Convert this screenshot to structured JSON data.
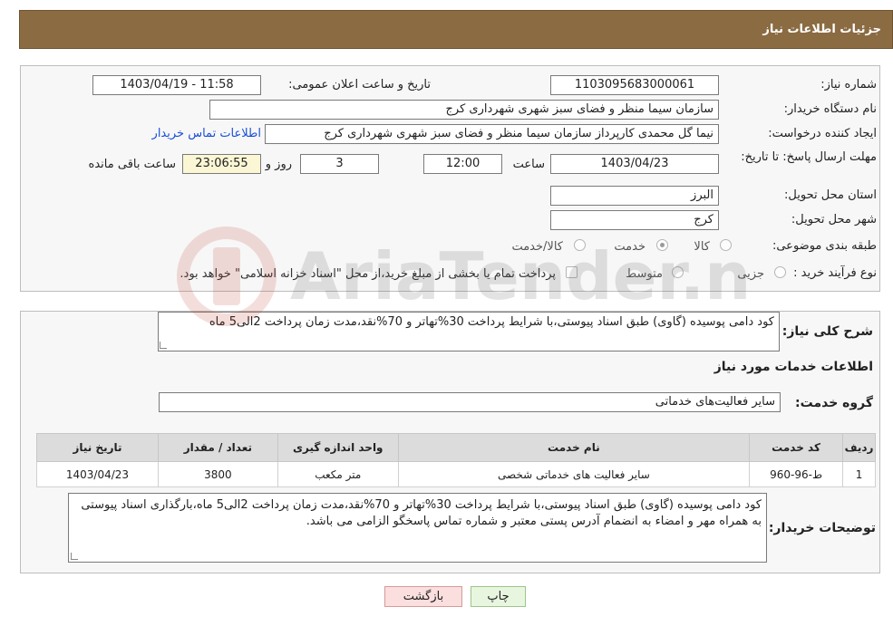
{
  "header": {
    "title": "جزئیات اطلاعات نیاز"
  },
  "labels": {
    "need_number": "شماره نیاز:",
    "announce_datetime": "تاریخ و ساعت اعلان عمومی:",
    "buyer_org": "نام دستگاه خریدار:",
    "request_creator": "ایجاد کننده درخواست:",
    "deadline": "مهلت ارسال پاسخ: تا تاریخ:",
    "time": "ساعت",
    "days_and": "روز و",
    "remaining": "ساعت باقی مانده",
    "province": "استان محل تحویل:",
    "city": "شهر محل تحویل:",
    "category": "طبقه بندی موضوعی:",
    "purchase_type": "نوع فرآیند خرید :",
    "general_description": "شرح کلی نیاز:",
    "services_info": "اطلاعات خدمات مورد نیاز",
    "service_group": "گروه خدمت:",
    "buyer_notes": "توضیحات خریدار:"
  },
  "values": {
    "need_number": "1103095683000061",
    "announce_datetime": "1403/04/19 - 11:58",
    "buyer_org": "سازمان سیما منظر و فضای سبز شهری شهرداری کرج",
    "request_creator": "نیما گل محمدی کارپرداز سازمان سیما منظر و فضای سبز شهری شهرداری کرج",
    "deadline_date": "1403/04/23",
    "deadline_time": "12:00",
    "days": "3",
    "remaining_time": "23:06:55",
    "province": "البرز",
    "city": "کرج",
    "general_description": "کود دامی پوسیده (گاوی) طبق اسناد پیوستی،با شرایط پرداخت 30%تهاتر و 70%نقد،مدت زمان پرداخت 2الی5 ماه",
    "service_group": "سایر فعالیت‌های خدماتی",
    "buyer_notes": "کود دامی پوسیده (گاوی) طبق اسناد پیوستی،با شرایط پرداخت 30%تهاتر و 70%نقد،مدت زمان پرداخت 2الی5 ماه،بارگذاری اسناد پیوستی به همراه مهر و امضاء به انضمام آدرس پستی معتبر و شماره تماس پاسخگو الزامی می باشد."
  },
  "links": {
    "buyer_contact": "اطلاعات تماس خریدار"
  },
  "category_options": [
    "کالا",
    "خدمت",
    "کالا/خدمت"
  ],
  "category_selected": "خدمت",
  "purchase_options": [
    "جزیی",
    "متوسط"
  ],
  "treasury_note": "پرداخت تمام یا بخشی از مبلغ خرید،از محل \"اسناد خزانه اسلامی\" خواهد بود.",
  "table": {
    "headers": [
      "ردیف",
      "کد خدمت",
      "نام خدمت",
      "واحد اندازه گیری",
      "تعداد / مقدار",
      "تاریخ نیاز"
    ],
    "rows": [
      [
        "1",
        "ط-96-960",
        "سایر فعالیت های خدماتی شخصی",
        "متر مکعب",
        "3800",
        "1403/04/23"
      ]
    ]
  },
  "buttons": {
    "print": "چاپ",
    "back": "بازگشت"
  },
  "watermark": {
    "text": "AriaTender.neT"
  },
  "colors": {
    "header_bg": "#8b6b42",
    "link": "#1a4fd8",
    "print_bg": "#e9f6df",
    "back_bg": "#fbdede"
  }
}
